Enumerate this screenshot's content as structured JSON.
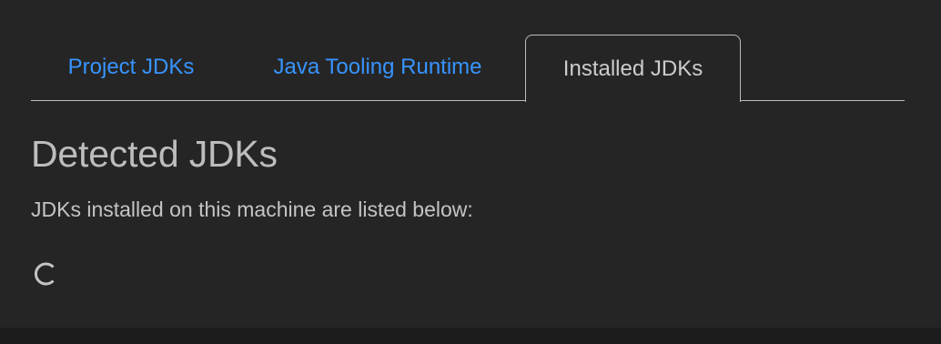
{
  "tabs": {
    "project_jdks": "Project JDKs",
    "java_tooling_runtime": "Java Tooling Runtime",
    "installed_jdks": "Installed JDKs",
    "active": "installed_jdks"
  },
  "section": {
    "title": "Detected JDKs",
    "description": "JDKs installed on this machine are listed below:"
  },
  "loading": {
    "icon": "loading-spinner-icon"
  },
  "colors": {
    "link": "#3794ff",
    "active_tab_text": "#cccccc",
    "background": "#252525",
    "border": "#bdbdbd"
  }
}
